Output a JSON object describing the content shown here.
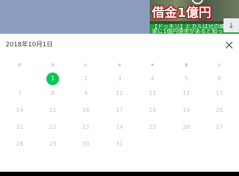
{
  "thumbnail": {
    "title": "借金1億円",
    "caption": "【ドッキリ】ヒカルは兄の嫁に実家に1億円借金があると知っ"
  },
  "calendar": {
    "title": "2018年10月1日",
    "weekdays": [
      "日",
      "月",
      "火",
      "水",
      "木",
      "金",
      "土"
    ],
    "weeks": [
      [
        "",
        "1",
        "2",
        "3",
        "4",
        "5",
        "6"
      ],
      [
        "7",
        "8",
        "9",
        "10",
        "11",
        "12",
        "13"
      ],
      [
        "14",
        "15",
        "16",
        "17",
        "18",
        "19",
        "20"
      ],
      [
        "21",
        "22",
        "23",
        "24",
        "25",
        "26",
        "27"
      ],
      [
        "28",
        "29",
        "30",
        "31",
        "",
        "",
        ""
      ]
    ],
    "selected_day": "1"
  },
  "icons": {
    "close": "close-icon",
    "arrow": "arrow-down-icon",
    "thumb_ring": "ring-icon"
  },
  "colors": {
    "accent": "#06c755",
    "background_strip": "#8a9dbf",
    "caption_bar": "#1f9a3a"
  }
}
